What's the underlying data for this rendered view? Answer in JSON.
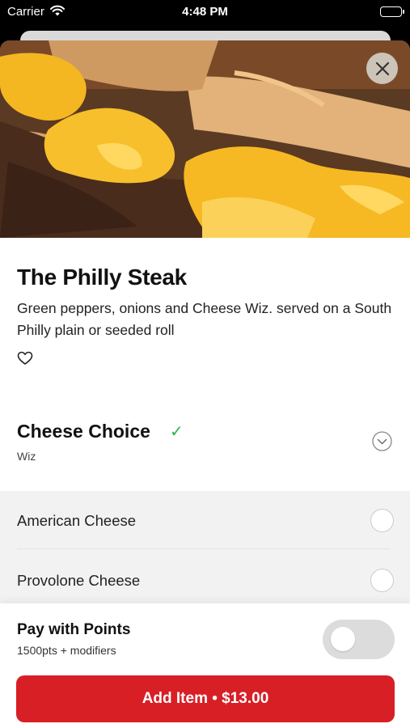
{
  "status_bar": {
    "carrier": "Carrier",
    "time": "4:48 PM"
  },
  "item": {
    "name": "The Philly Steak",
    "description": "Green peppers, onions and Cheese Wiz. served on a South Philly plain or seeded roll",
    "favorite": false
  },
  "modifier_group": {
    "title": "Cheese Choice",
    "selected": "Wiz",
    "complete": true,
    "options": [
      {
        "label": "American Cheese",
        "selected": false
      },
      {
        "label": "Provolone Cheese",
        "selected": false
      }
    ]
  },
  "points": {
    "title": "Pay with Points",
    "subtitle": "1500pts + modifiers",
    "enabled": false
  },
  "add_button": {
    "label": "Add Item • $13.00"
  },
  "icons": {
    "close": "close-icon",
    "favorite": "heart-icon",
    "expand": "chevron-down-icon",
    "check": "checkmark-icon"
  },
  "colors": {
    "accent": "#d81f26",
    "success": "#2db34a",
    "toggle_off": "#dcdcdc"
  }
}
